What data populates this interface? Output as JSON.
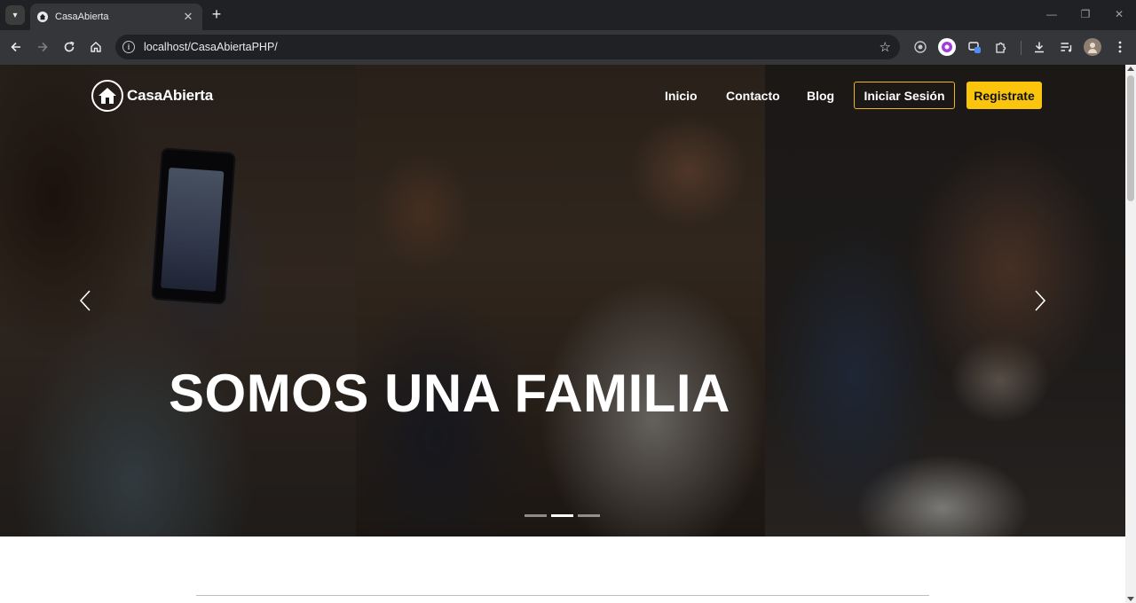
{
  "browser": {
    "tab_title": "CasaAbierta",
    "tab_close": "✕",
    "new_tab": "+",
    "url": "localhost/CasaAbiertaPHP/",
    "window_controls": {
      "minimize": "—",
      "maximize": "❐",
      "close": "✕"
    }
  },
  "site": {
    "logo_text": "CasaAbierta",
    "nav": {
      "inicio": "Inicio",
      "contacto": "Contacto",
      "blog": "Blog",
      "login": "Iniciar Sesión",
      "register": "Registrate"
    },
    "hero": {
      "title": "SOMOS UNA FAMILIA",
      "carousel_slides_total": 3,
      "carousel_active_index": 2
    },
    "colors": {
      "accent": "#fbc50d",
      "accent_border": "#f1b51b",
      "text_on_dark": "#ffffff"
    }
  }
}
